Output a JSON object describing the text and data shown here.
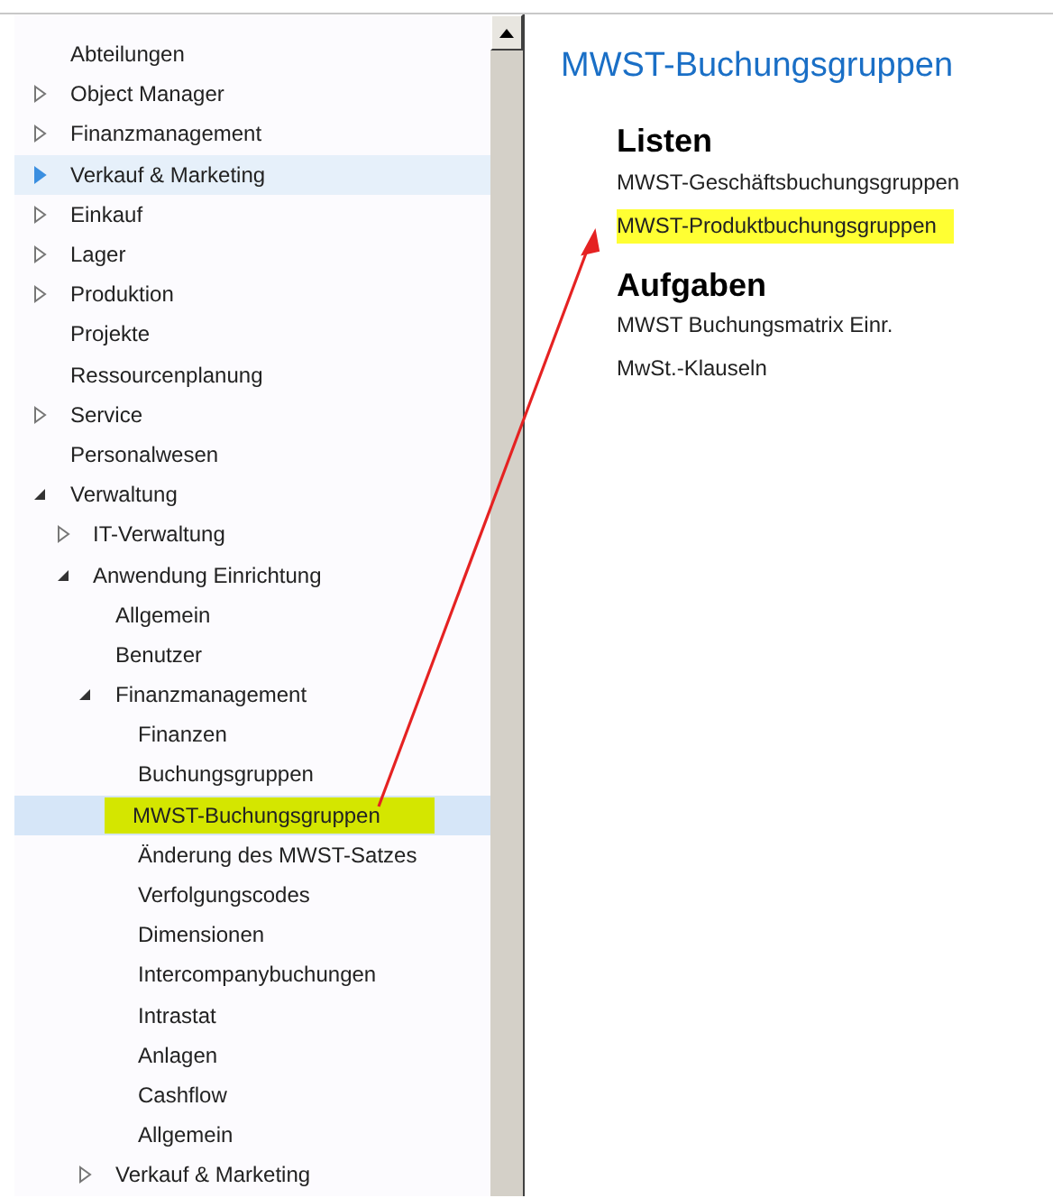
{
  "nav_tree": [
    {
      "label": "Abteilungen",
      "selected": false,
      "hovered": false,
      "highlighted": false
    },
    {
      "label": "Object Manager",
      "expanded": false,
      "selected": false,
      "hovered": false,
      "highlighted": false
    },
    {
      "label": "Finanzmanagement",
      "expanded": false,
      "selected": false,
      "hovered": false,
      "highlighted": false
    },
    {
      "label": "Verkauf & Marketing",
      "expanded": false,
      "selected": false,
      "hovered": true,
      "highlighted": false
    },
    {
      "label": "Einkauf",
      "expanded": false,
      "selected": false,
      "hovered": false,
      "highlighted": false
    },
    {
      "label": "Lager",
      "expanded": false,
      "selected": false,
      "hovered": false,
      "highlighted": false
    },
    {
      "label": "Produktion",
      "expanded": false,
      "selected": false,
      "hovered": false,
      "highlighted": false
    },
    {
      "label": "Projekte",
      "selected": false,
      "hovered": false,
      "highlighted": false
    },
    {
      "label": "Ressourcenplanung",
      "selected": false,
      "hovered": false,
      "highlighted": false
    },
    {
      "label": "Service",
      "expanded": false,
      "selected": false,
      "hovered": false,
      "highlighted": false
    },
    {
      "label": "Personalwesen",
      "selected": false,
      "hovered": false,
      "highlighted": false
    },
    {
      "label": "Verwaltung",
      "expanded": true,
      "selected": false,
      "hovered": false,
      "highlighted": false,
      "children": [
        {
          "label": "IT-Verwaltung",
          "expanded": false,
          "selected": false,
          "hovered": false,
          "highlighted": false
        },
        {
          "label": "Anwendung Einrichtung",
          "expanded": true,
          "selected": false,
          "hovered": false,
          "highlighted": false,
          "children": [
            {
              "label": "Allgemein",
              "selected": false,
              "hovered": false,
              "highlighted": false
            },
            {
              "label": "Benutzer",
              "selected": false,
              "hovered": false,
              "highlighted": false
            },
            {
              "label": "Finanzmanagement",
              "expanded": true,
              "selected": false,
              "hovered": false,
              "highlighted": false,
              "children": [
                {
                  "label": "Finanzen",
                  "selected": false,
                  "hovered": false,
                  "highlighted": false
                },
                {
                  "label": "Buchungsgruppen",
                  "selected": false,
                  "hovered": false,
                  "highlighted": false
                },
                {
                  "label": "MWST-Buchungsgruppen",
                  "selected": true,
                  "hovered": false,
                  "highlighted": true
                },
                {
                  "label": "Änderung des MWST-Satzes",
                  "selected": false,
                  "hovered": false,
                  "highlighted": false
                },
                {
                  "label": "Verfolgungscodes",
                  "selected": false,
                  "hovered": false,
                  "highlighted": false
                },
                {
                  "label": "Dimensionen",
                  "selected": false,
                  "hovered": false,
                  "highlighted": false
                },
                {
                  "label": "Intercompanybuchungen",
                  "selected": false,
                  "hovered": false,
                  "highlighted": false
                },
                {
                  "label": "Intrastat",
                  "selected": false,
                  "hovered": false,
                  "highlighted": false
                },
                {
                  "label": "Anlagen",
                  "selected": false,
                  "hovered": false,
                  "highlighted": false
                },
                {
                  "label": "Cashflow",
                  "selected": false,
                  "hovered": false,
                  "highlighted": false
                },
                {
                  "label": "Allgemein",
                  "selected": false,
                  "hovered": false,
                  "highlighted": false
                }
              ]
            },
            {
              "label": "Verkauf & Marketing",
              "expanded": false,
              "selected": false,
              "hovered": false,
              "highlighted": false
            }
          ]
        }
      ]
    }
  ],
  "content": {
    "title": "MWST-Buchungsgruppen",
    "sections": [
      {
        "heading": "Listen",
        "links": [
          {
            "label": "MWST-Geschäftsbuchungsgruppen",
            "highlighted": false
          },
          {
            "label": "MWST-Produktbuchungsgruppen",
            "highlighted": true
          }
        ]
      },
      {
        "heading": "Aufgaben",
        "links": [
          {
            "label": "MWST Buchungsmatrix Einr.",
            "highlighted": false
          },
          {
            "label": "MwSt.-Klauseln",
            "highlighted": false
          }
        ]
      }
    ]
  }
}
